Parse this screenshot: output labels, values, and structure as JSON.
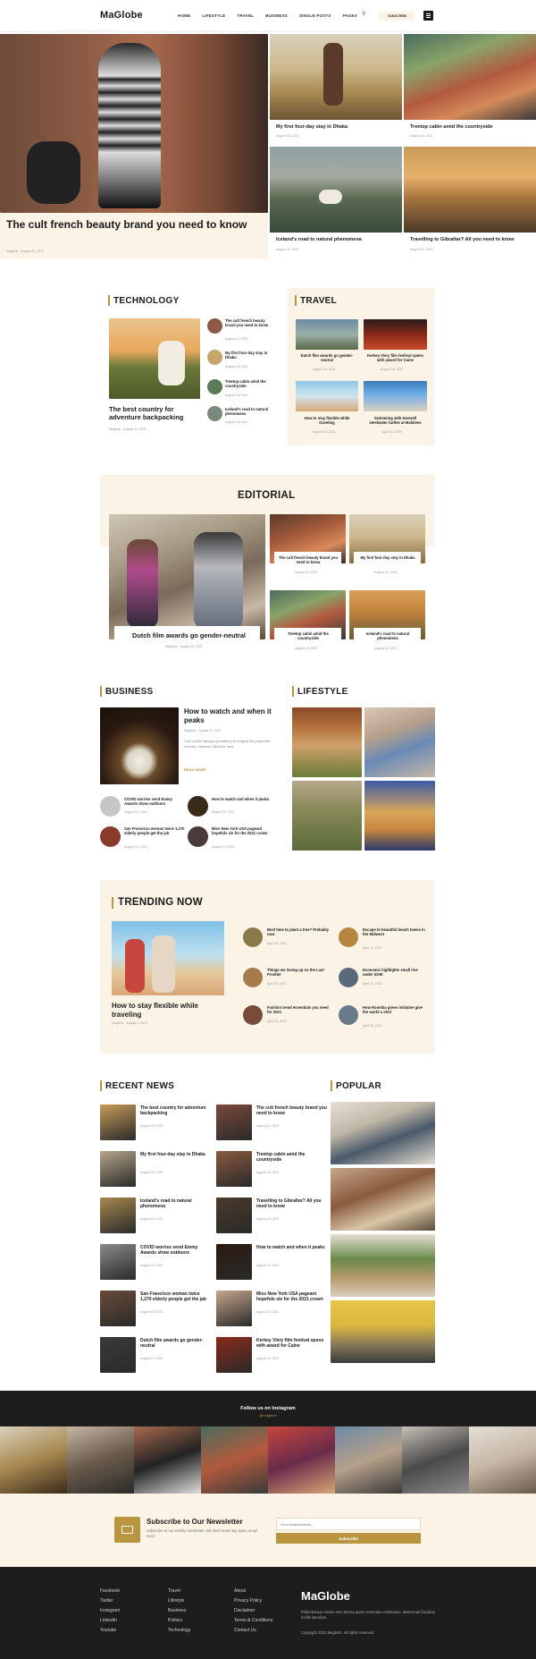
{
  "brand": {
    "logo": "MaGlobe"
  },
  "nav": {
    "items": [
      "HOME",
      "LIFESTYLE",
      "TRAVEL",
      "BUSINESS",
      "SINGLE POSTS",
      "PAGES"
    ],
    "subscribe": "SUBSCRIBE"
  },
  "hero": {
    "main_title": "The cult french beauty brand you need to know",
    "main_meta": "Magbirtz · August 23, 2021",
    "cards": [
      {
        "title": "My first four-day stay in Dhaka",
        "meta": "August 16, 2021"
      },
      {
        "title": "Treetop cabin amid the countryside",
        "meta": "August 18, 2021"
      },
      {
        "title": "Iceland's road to natural phenomena",
        "meta": "August 16, 2021"
      },
      {
        "title": "Travelling to Gibraltar? All you need to know",
        "meta": "August 19, 2021"
      }
    ]
  },
  "technology": {
    "heading": "TECHNOLOGY",
    "main_title": "The best country for adventure backpacking",
    "main_meta": "Magbirtz · August 24, 2021",
    "items": [
      {
        "title": "The cult french beauty brand you need to know",
        "meta": "August 23, 2021"
      },
      {
        "title": "My first four-day stay in Dhaka",
        "meta": "August 22, 2021"
      },
      {
        "title": "Treetop cabin amid the countryside",
        "meta": "August 18, 2021"
      },
      {
        "title": "Iceland's road to natural phenomena",
        "meta": "August 16, 2021"
      }
    ]
  },
  "travel": {
    "heading": "TRAVEL",
    "items": [
      {
        "title": "Dutch film awards go gender-neutral",
        "meta": "August 19, 2021"
      },
      {
        "title": "Kerkey Viery film festival opens with award for Caine",
        "meta": "August 16, 2021"
      },
      {
        "title": "How to stay flexible while traveling",
        "meta": "August 10, 2021"
      },
      {
        "title": "Swimming with Haswell steelwater turtles at Maldives",
        "meta": "April 10, 2022"
      }
    ]
  },
  "editorial": {
    "heading": "EDITORIAL",
    "main_title": "Dutch film awards go gender-neutral",
    "main_meta": "Magbirtz · August 23, 2021",
    "items": [
      {
        "title": "The cult french beauty brand you need to know",
        "meta": "August 23, 2021"
      },
      {
        "title": "My first four-day stay in Dhaka",
        "meta": "August 22, 2021"
      },
      {
        "title": "Treetop cabin amid the countryside",
        "meta": "August 18, 2021"
      },
      {
        "title": "Iceland's road to natural phenomena",
        "meta": "August 16, 2021"
      }
    ]
  },
  "business": {
    "heading": "BUSINESS",
    "main_title": "How to watch and when it peaks",
    "main_meta": "Magbirtz · August 24, 2021",
    "excerpt": "Cum sociis natoque penatibus et magnis dis parturient montes, nascetur ridiculus mus.",
    "read_more": "READ MORE",
    "items": [
      {
        "title": "COVID worries send Emmy Awards show outdoors",
        "meta": "August 24, 2021"
      },
      {
        "title": "How to watch and when it peaks",
        "meta": "August 23, 2021"
      },
      {
        "title": "San Francisco woman twice 1,270 elderly people get the jab",
        "meta": "August 24, 2021"
      },
      {
        "title": "Miss New York USA pageant hopefuls vie for the 2021 crown",
        "meta": "August 23, 2021"
      }
    ]
  },
  "lifestyle": {
    "heading": "LIFESTYLE"
  },
  "trending": {
    "heading": "TRENDING NOW",
    "main_title": "How to stay flexible while traveling",
    "main_meta": "Magbirtz · August 1, 2022",
    "items": [
      {
        "title": "Best time to plant a tree? Probably now",
        "meta": "April 16, 2022"
      },
      {
        "title": "Escape to beautiful beach towns in the Midwest",
        "meta": "April 16, 2022"
      },
      {
        "title": "Things we loving up on the Last Frontier",
        "meta": "April 16, 2022"
      },
      {
        "title": "Economic highlights small rise under $20K",
        "meta": "April 16, 2022"
      },
      {
        "title": "Fashion trend essentials you need for 2021",
        "meta": "April 16, 2022"
      },
      {
        "title": "How Roomba green initiative give the world a shot",
        "meta": "April 16, 2022"
      }
    ]
  },
  "recent": {
    "heading": "RECENT NEWS",
    "items": [
      {
        "title": "The best country for adventure backpacking",
        "meta": "August 24, 2021"
      },
      {
        "title": "The cult french beauty brand you need to know",
        "meta": "August 23, 2021"
      },
      {
        "title": "My first four-day stay in Dhaka",
        "meta": "August 22, 2021"
      },
      {
        "title": "Treetop cabin amid the countryside",
        "meta": "August 18, 2021"
      },
      {
        "title": "Iceland's road to natural phenomena",
        "meta": "August 16, 2021"
      },
      {
        "title": "Travelling to Gibraltar? All you need to know",
        "meta": "August 19, 2021"
      },
      {
        "title": "COVID worries send Emmy Awards show outdoors",
        "meta": "August 24, 2021"
      },
      {
        "title": "How to watch and when it peaks",
        "meta": "August 23, 2021"
      },
      {
        "title": "San Francisco woman twice 1,270 elderly people get the jab",
        "meta": "August 23, 2021"
      },
      {
        "title": "Miss New York USA pageant hopefuls vie for the 2021 crown",
        "meta": "August 23, 2021"
      },
      {
        "title": "Dutch film awards go gender-neutral",
        "meta": "August 19, 2021"
      },
      {
        "title": "Kerkey Viery film festival opens with award for Caine",
        "meta": "August 16, 2021"
      }
    ]
  },
  "popular": {
    "heading": "POPULAR"
  },
  "instagram": {
    "heading": "Follow us on Instagram",
    "handle": "@magbirtz"
  },
  "newsletter": {
    "title": "Subscribe to Our Newsletter",
    "desc": "Subscribe to our weekly newsletter. We don't send any spam email ever!",
    "placeholder": "Your email address...",
    "button": "Subscribe"
  },
  "footer": {
    "social": [
      "Facebook",
      "Twitter",
      "Instagram",
      "LinkedIn",
      "Youtube"
    ],
    "cats": [
      "Travel",
      "Lifestyle",
      "Business",
      "Politics",
      "Technology"
    ],
    "links": [
      "About",
      "Privacy Policy",
      "Disclaimer",
      "Terms & Conditions",
      "Contact Us"
    ],
    "logo": "MaGlobe",
    "desc": "Pellentesque ornare sem lacinia quam venenatis vestibulum. Maecenas faucibus mollis interdum.",
    "copyright": "Copyright 2022 Magbirtz. All rights reserved."
  },
  "colors": {
    "accent": "#b9953f",
    "cream": "#fbf4e6",
    "dark": "#1d1d1d"
  }
}
